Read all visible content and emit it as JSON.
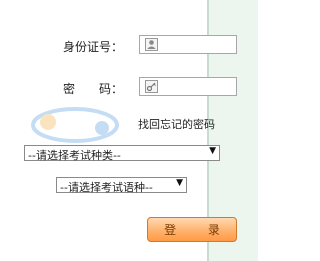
{
  "form": {
    "id_label": "身份证号：",
    "pwd_label": "密　　码：",
    "id_value": "",
    "pwd_value": "",
    "forgot_link": "找回忘记的密码",
    "exam_type_select": "--请选择考试种类--",
    "exam_lang_select": "--请选择考试语种--",
    "login_button": "登 录"
  },
  "icons": {
    "id_icon": "user-icon",
    "pwd_icon": "key-icon",
    "select_arrow": "▼"
  },
  "colors": {
    "button_bg": "#ffb26e",
    "side_strip": "#ecf5ee"
  }
}
